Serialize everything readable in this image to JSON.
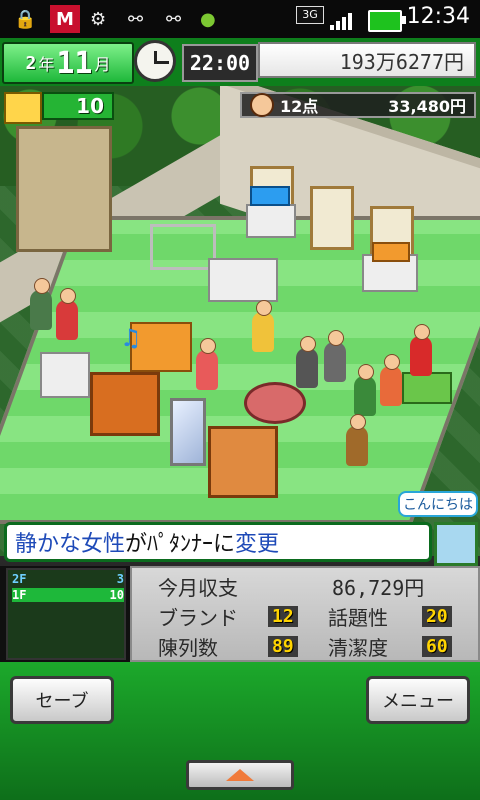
{
  "status_bar": {
    "icons": [
      "lock-icon",
      "mcafee-icon",
      "android-debug-icon",
      "usb-icon",
      "usb-icon",
      "android-icon"
    ],
    "network": "3G",
    "time": "12:34"
  },
  "hud": {
    "year": "2",
    "year_unit": "年",
    "month": "11",
    "month_unit": "月",
    "clock_time": "22:00",
    "money": "193万6277円"
  },
  "game": {
    "shirt_count": "10",
    "points": "12点",
    "score": "33,480円",
    "speech_bubble": "こんにちは",
    "message_highlight_1": "静かな女性",
    "message_part_2": "がﾊﾟﾀﾝﾅｰに",
    "message_highlight_2": "変更"
  },
  "floors": [
    {
      "floor": "2F",
      "count": "3",
      "color": "#6fd0ff"
    },
    {
      "floor": "1F",
      "count": "10",
      "color": "#ffffff"
    }
  ],
  "stats": {
    "monthly_label": "今月収支",
    "monthly_value": "86,729円",
    "brand_label": "ブランド",
    "brand_value": "12",
    "topic_label": "話題性",
    "topic_value": "20",
    "display_label": "陳列数",
    "display_value": "89",
    "clean_label": "清潔度",
    "clean_value": "60"
  },
  "buttons": {
    "save": "セーブ",
    "menu": "メニュー"
  },
  "colors": {
    "hud_green": "#0e7f1c",
    "bottom_green": "#1ca92b",
    "highlight_blue": "#1e4ab8",
    "value_yellow": "#ffd400"
  }
}
